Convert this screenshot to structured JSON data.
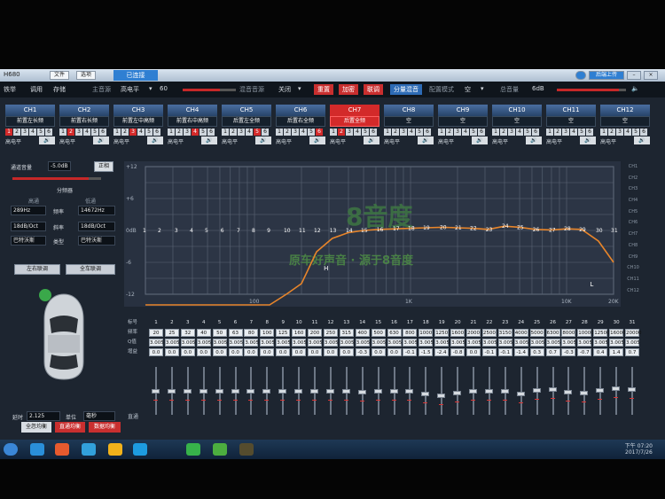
{
  "title_bar": {
    "app_name": "H680",
    "file_menu": "文件",
    "options_menu": "选项",
    "connected": "已连接",
    "upload": "后端上传"
  },
  "toolbar": {
    "partial_1": "铁举",
    "tune": "调用",
    "save": "存储",
    "master_label": "主音源",
    "master_value": "高电平",
    "master_num": "60",
    "mix_label": "混音音源",
    "mix_value": "关闭",
    "reset": "重置",
    "encrypt": "加密",
    "link": "联调",
    "split_mix": "分量混音",
    "mode_label": "配置模式",
    "mode_value": "空",
    "total_label": "总音量",
    "total_value": "6dB"
  },
  "channels": [
    {
      "id": "CH1",
      "name": "前置左长频",
      "on": 1,
      "mode": "高电平"
    },
    {
      "id": "CH2",
      "name": "前置右长频",
      "on": 2,
      "mode": "高电平"
    },
    {
      "id": "CH3",
      "name": "前置左中高频",
      "on": 3,
      "mode": "高电平"
    },
    {
      "id": "CH4",
      "name": "前置右中高频",
      "on": 4,
      "mode": "高电平"
    },
    {
      "id": "CH5",
      "name": "后置左全频",
      "on": 5,
      "mode": "高电平"
    },
    {
      "id": "CH6",
      "name": "后置右全频",
      "on": 6,
      "mode": "高电平"
    },
    {
      "id": "CH7",
      "name": "后置全频",
      "on": 2,
      "mode": "高电平",
      "active": true
    },
    {
      "id": "CH8",
      "name": "空",
      "on": 0,
      "mode": "高电平"
    },
    {
      "id": "CH9",
      "name": "空",
      "on": 0,
      "mode": "高电平"
    },
    {
      "id": "CH10",
      "name": "空",
      "on": 0,
      "mode": "高电平"
    },
    {
      "id": "CH11",
      "name": "空",
      "on": 0,
      "mode": "高电平"
    },
    {
      "id": "CH12",
      "name": "空",
      "on": 0,
      "mode": "高电平"
    }
  ],
  "channel_numbers": [
    "1",
    "2",
    "3",
    "4",
    "5",
    "6"
  ],
  "left_panel": {
    "gain_label": "通道音量",
    "gain_value": "-5.0dB",
    "phase_btn": "正相",
    "crossover_label": "分频器",
    "hp_label": "高通",
    "lp_label": "低通",
    "hp_freq": "289Hz",
    "freq_label": "频率",
    "lp_freq": "14672Hz",
    "hp_slope": "18dB/Oct",
    "slope_label": "斜率",
    "lp_slope": "18dB/Oct",
    "hp_type": "巴特沃斯",
    "type_label": "类型",
    "lp_type": "巴特沃斯",
    "lr_link": "左右联调",
    "all_link": "全车联调",
    "delay_label": "延时",
    "delay_value": "2.125",
    "unit_label": "单位",
    "unit_value": "毫秒"
  },
  "bottom_buttons": {
    "cancel": "全忽均衡",
    "eq": "直通均衡",
    "reset_eq": "数据均衡"
  },
  "graph": {
    "y_ticks": [
      "+12",
      "+6",
      "0dB",
      "-6",
      "-12"
    ],
    "x_ticks": [
      "100",
      "1K",
      "10K",
      "20K"
    ],
    "watermark_top": "8音度",
    "watermark_bottom": "原车好声音 · 源于8音度",
    "marker_h": "H",
    "marker_l": "L",
    "band_labels": [
      "1",
      "2",
      "3",
      "4",
      "5",
      "6",
      "7",
      "8",
      "9",
      "10",
      "11",
      "12",
      "13",
      "14",
      "15",
      "16",
      "17",
      "18",
      "19",
      "20",
      "21",
      "22",
      "23",
      "24",
      "25",
      "26",
      "27",
      "28",
      "29",
      "30",
      "31"
    ],
    "legend": [
      "CH1",
      "CH2",
      "CH3",
      "CH4",
      "CH5",
      "CH6",
      "CH7",
      "CH8",
      "CH9",
      "CH10",
      "CH11",
      "CH12"
    ]
  },
  "chart_data": {
    "type": "line",
    "title": "",
    "xlabel": "",
    "ylabel": "",
    "x_scale": "log",
    "xlim": [
      20,
      20000
    ],
    "ylim": [
      -12,
      12
    ],
    "grid": true,
    "x": [
      20,
      25,
      32,
      40,
      50,
      63,
      80,
      100,
      125,
      160,
      200,
      250,
      315,
      400,
      500,
      630,
      800,
      1000,
      1250,
      1600,
      2000,
      2500,
      3150,
      4000,
      5000,
      6300,
      8000,
      10000,
      12500,
      16000,
      20000
    ],
    "series": [
      {
        "values": [
          -30,
          -28,
          -26,
          -24,
          -22,
          -20,
          -18,
          -16,
          -14,
          -12,
          -10,
          -4,
          -1.5,
          -0.4,
          0,
          0.2,
          0.3,
          0.4,
          0.5,
          0.6,
          0.5,
          0.4,
          0.2,
          0.8,
          0.6,
          0.2,
          0.1,
          0.3,
          0.2,
          -2,
          -6
        ]
      }
    ]
  },
  "eq_table": {
    "row_labels": [
      "标号",
      "频率",
      "Q值",
      "增益"
    ],
    "bands": [
      "1",
      "2",
      "3",
      "4",
      "5",
      "6",
      "7",
      "8",
      "9",
      "10",
      "11",
      "12",
      "13",
      "14",
      "15",
      "16",
      "17",
      "18",
      "19",
      "20",
      "21",
      "22",
      "23",
      "24",
      "25",
      "26",
      "27",
      "28",
      "29",
      "30",
      "31"
    ],
    "freqs": [
      "20",
      "25",
      "32",
      "40",
      "50",
      "63",
      "80",
      "100",
      "125",
      "160",
      "200",
      "250",
      "315",
      "400",
      "500",
      "630",
      "800",
      "1000",
      "1250",
      "1600",
      "2000",
      "2500",
      "3150",
      "4000",
      "5000",
      "6300",
      "8000",
      "10000",
      "12500",
      "16000",
      "20000"
    ],
    "q": [
      "3.005",
      "3.005",
      "3.005",
      "3.005",
      "3.005",
      "3.005",
      "3.005",
      "3.005",
      "3.005",
      "3.005",
      "3.005",
      "3.005",
      "3.005",
      "3.005",
      "3.005",
      "3.005",
      "3.005",
      "3.005",
      "3.005",
      "3.005",
      "3.005",
      "3.005",
      "3.005",
      "3.005",
      "3.005",
      "3.005",
      "3.005",
      "3.005",
      "3.005",
      "3.005",
      "3.005"
    ],
    "gain": [
      "0.0",
      "0.0",
      "0.0",
      "0.0",
      "0.0",
      "0.0",
      "0.0",
      "0.0",
      "0.0",
      "0.0",
      "0.0",
      "0.0",
      "0.0",
      "-0.3",
      "0.0",
      "0.0",
      "-0.1",
      "-1.5",
      "-2.4",
      "-0.8",
      "0.0",
      "-0.1",
      "-0.1",
      "-1.4",
      "0.3",
      "0.7",
      "-0.3",
      "-0.7",
      "0.4",
      "1.4",
      "0.7"
    ],
    "fader_label": "直通"
  },
  "taskbar": {
    "time": "下午 07:20",
    "date": "2017/7/26"
  },
  "colors": {
    "accent_red": "#d32a2a",
    "curve_orange": "#e8852a",
    "graph_bg": "#283140",
    "header_blue": "#3a5f93"
  }
}
